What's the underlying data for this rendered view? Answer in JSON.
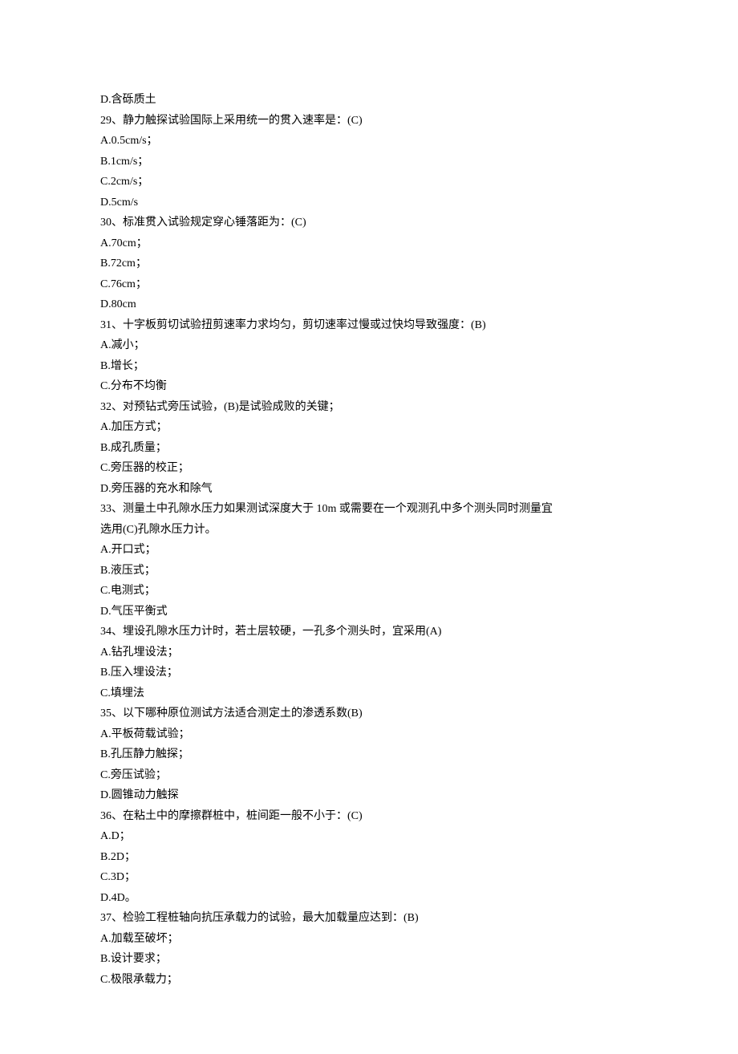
{
  "lines": [
    "D.含砾质土",
    "29、静力触探试验国际上采用统一的贯入速率是：(C)",
    "A.0.5cm/s；",
    "B.1cm/s；",
    "C.2cm/s；",
    "D.5cm/s",
    "30、标准贯入试验规定穿心锤落距为：(C)",
    "A.70cm；",
    "B.72cm；",
    "C.76cm；",
    "D.80cm",
    "31、十字板剪切试验扭剪速率力求均匀，剪切速率过慢或过快均导致强度：(B)",
    "A.减小；",
    "B.增长；",
    "C.分布不均衡",
    "32、对预钻式旁压试验，(B)是试验成败的关键；",
    "A.加压方式；",
    "B.成孔质量；",
    "C.旁压器的校正；",
    "D.旁压器的充水和除气",
    "33、测量土中孔隙水压力如果测试深度大于 10m 或需要在一个观测孔中多个测头同时测量宜",
    "选用(C)孔隙水压力计。",
    "A.开口式；",
    "B.液压式；",
    "C.电测式；",
    "D.气压平衡式",
    "34、埋设孔隙水压力计时，若土层较硬，一孔多个测头时，宜采用(A)",
    "A.钻孔埋设法；",
    "B.压入埋设法；",
    "C.填埋法",
    "35、以下哪种原位测试方法适合测定土的渗透系数(B)",
    "A.平板荷载试验；",
    "B.孔压静力触探；",
    "C.旁压试验；",
    "D.圆锥动力触探",
    "36、在粘土中的摩擦群桩中，桩间距一般不小于：(C)",
    "A.D；",
    "B.2D；",
    "C.3D；",
    "D.4D。",
    "37、检验工程桩轴向抗压承载力的试验，最大加载量应达到：(B)",
    "A.加载至破坏；",
    "B.设计要求；",
    "C.极限承载力；"
  ]
}
